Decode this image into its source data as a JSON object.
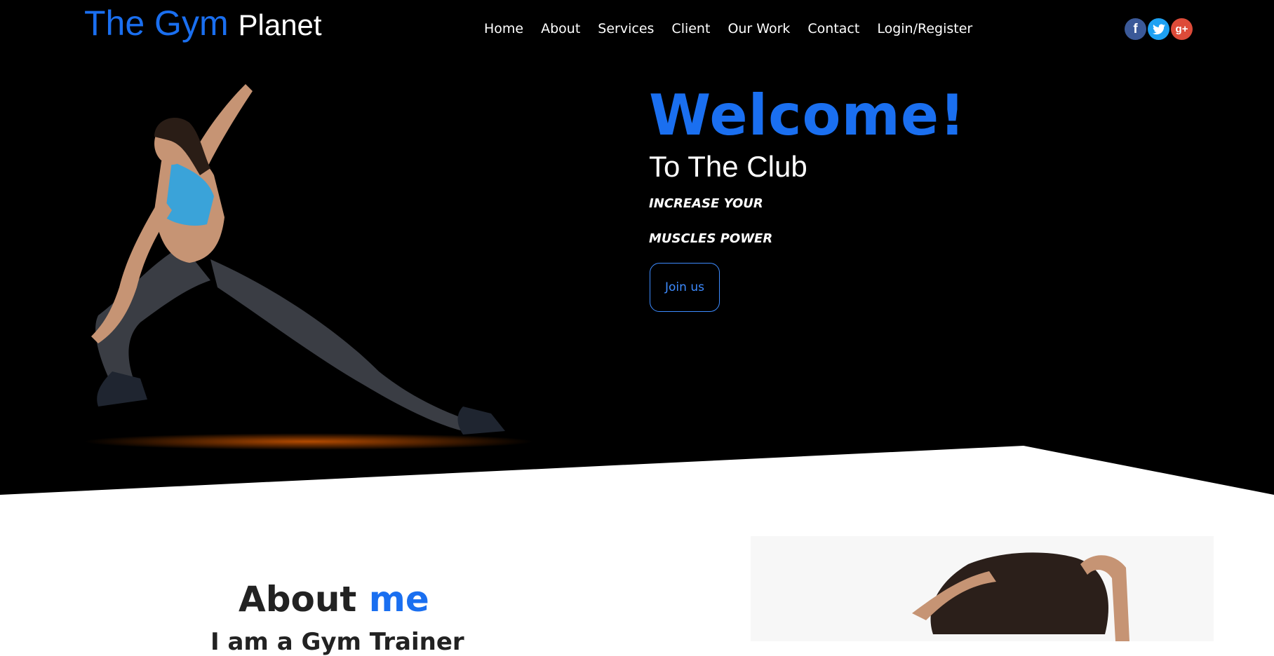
{
  "header": {
    "logo_part1": "The Gym",
    "logo_part2": "Planet",
    "nav": [
      "Home",
      "About",
      "Services",
      "Client",
      "Our Work",
      "Contact",
      "Login/Register"
    ],
    "social": [
      {
        "icon": "facebook-icon",
        "glyph": "f",
        "color": "#3b5998"
      },
      {
        "icon": "twitter-icon",
        "glyph": "🐦",
        "color": "#1da1f2"
      },
      {
        "icon": "google-plus-icon",
        "glyph": "g+",
        "color": "#dd4b39"
      }
    ]
  },
  "hero": {
    "welcome": "Welcome!",
    "club": "To The Club",
    "tag1": "INCREASE YOUR",
    "tag2": "MUSCLES POWER",
    "join": "Join us"
  },
  "about": {
    "title_part1": "About",
    "title_part2": "me",
    "subtitle": "I am a Gym Trainer"
  },
  "colors": {
    "accent": "#1a6ff0",
    "hero_bg": "#000000"
  }
}
